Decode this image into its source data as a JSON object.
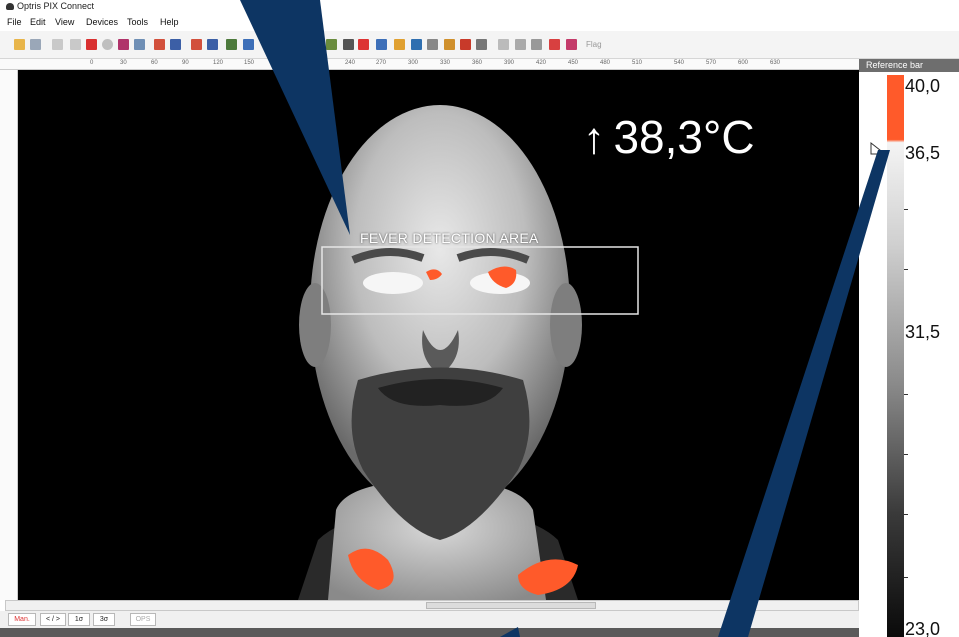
{
  "window": {
    "title": "Optris PIX Connect"
  },
  "menu": {
    "items": [
      "File",
      "Edit",
      "View",
      "Devices",
      "Tools",
      "Help"
    ]
  },
  "toolbar": {
    "flag_label": "Flag"
  },
  "ruler_h": {
    "ticks": [
      "0",
      "30",
      "60",
      "90",
      "120",
      "150",
      "240",
      "270",
      "300",
      "330",
      "360",
      "390",
      "420",
      "450",
      "480",
      "510",
      "540",
      "570",
      "600",
      "630"
    ]
  },
  "thermal": {
    "temperature_reading": "38,3°C",
    "arrow": "↑",
    "detection_area_label": "FEVER DETECTION AREA"
  },
  "reference_bar": {
    "title": "Reference bar",
    "max_label": "40,0",
    "threshold_label": "36,5",
    "mid_label": "31,5",
    "min_label": "23,0"
  },
  "controls": {
    "buttons": [
      "Man.",
      "< / >",
      "1σ",
      "3σ",
      "OPS"
    ]
  },
  "colors": {
    "alarm": "#ff5a2a",
    "annotation": "#0d3563"
  },
  "icons": [
    "app-icon",
    "open-folder-icon",
    "save-icon",
    "play-icon",
    "pause-icon",
    "stop-icon",
    "record-icon",
    "snapshot-icon",
    "palette-icon",
    "flag-icon"
  ]
}
